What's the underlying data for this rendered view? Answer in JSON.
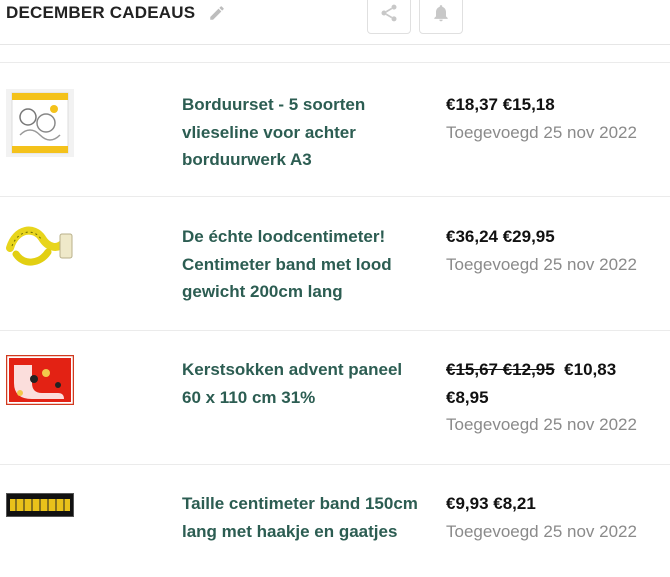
{
  "header": {
    "title": "DECEMBER CADEAUS"
  },
  "items": [
    {
      "name": "Borduurset - 5 soorten vlieseline voor achter borduurwerk A3",
      "price_line": "€18,37 €15,18",
      "added": "Toegevoegd 25 nov 2022"
    },
    {
      "name": "De échte loodcentimeter! Centimeter band met lood gewicht 200cm lang",
      "price_line": "€36,24 €29,95",
      "added": "Toegevoegd 25 nov 2022"
    },
    {
      "name": "Kerstsokken advent paneel 60 x 110 cm 31%",
      "old_price": "€15,67 €12,95",
      "new_price": "€10,83",
      "new_price2": "€8,95",
      "added": "Toegevoegd 25 nov 2022"
    },
    {
      "name": "Taille centimeter band 150cm lang met haakje en gaatjes",
      "price_line": "€9,93 €8,21",
      "added": "Toegevoegd 25 nov 2022"
    }
  ]
}
